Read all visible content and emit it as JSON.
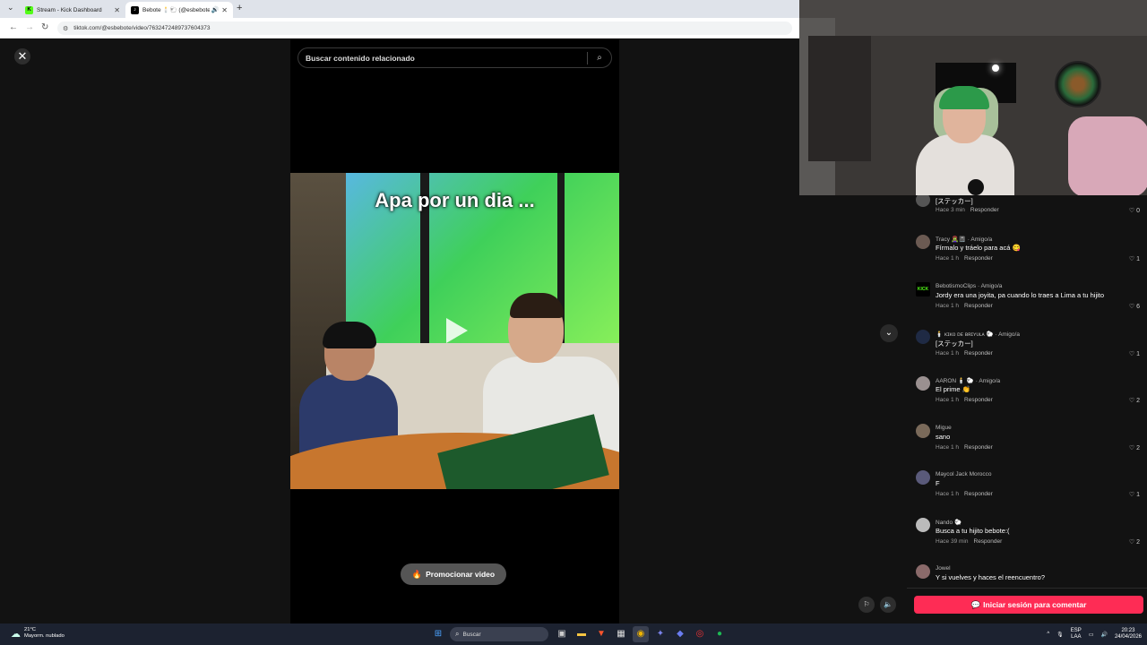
{
  "browser": {
    "tabs": [
      {
        "favicon": "K",
        "title": "Stream - Kick Dashboard"
      },
      {
        "favicon": "♪",
        "title": "Bebote 🕯️🐑 (@esbebote)"
      }
    ],
    "url": "tiktok.com/@esbebote/video/7632472489737604373"
  },
  "tiktok": {
    "search_placeholder": "Buscar contenido relacionado",
    "video_caption": "Apa por un dia ...",
    "promote_label": "Promocionar video",
    "login_to_comment": "Iniciar sesión para comentar"
  },
  "comments": [
    {
      "user": "",
      "text": "[ステッカー]",
      "time": "Hace 3 min",
      "reply": "Responder",
      "likes": "0"
    },
    {
      "user": "Tracy 🧟‍♀️📓 · Amigo/a",
      "text": "Fírmalo y tráelo para acá 😋",
      "time": "Hace 1 h",
      "reply": "Responder",
      "likes": "1"
    },
    {
      "user": "BebotismoClips · Amigo/a",
      "text": "Jordy era una joyita, pa cuando lo traes a Lima a tu hijito",
      "time": "Hace 1 h",
      "reply": "Responder",
      "likes": "6"
    },
    {
      "user": "🕯️ ᴋɪᴋᴏ ᴅᴇ ʙʀɪʏᴜʟᴀ 🐑 · Amigo/a",
      "text": "[ステッカー]",
      "time": "Hace 1 h",
      "reply": "Responder",
      "likes": "1"
    },
    {
      "user": "AARON 🕯️ 🐑 · Amigo/a",
      "text": "El prime 👏",
      "time": "Hace 1 h",
      "reply": "Responder",
      "likes": "2"
    },
    {
      "user": "Migue",
      "text": "sano",
      "time": "Hace 1 h",
      "reply": "Responder",
      "likes": "2"
    },
    {
      "user": "Maycol Jack Morocco",
      "text": "F",
      "time": "Hace 1 h",
      "reply": "Responder",
      "likes": "1"
    },
    {
      "user": "Nando 🐑",
      "text": "Busca a tu hijito bebote:(",
      "time": "Hace 39 min",
      "reply": "Responder",
      "likes": "2"
    },
    {
      "user": "Jowel",
      "text": "Y si vuelves y haces el reencuentro?",
      "time": "",
      "reply": "",
      "likes": ""
    }
  ],
  "taskbar": {
    "temp": "21°C",
    "weather": "Mayorm. nublado",
    "search_placeholder": "Buscar",
    "lang_1": "ESP",
    "lang_2": "LAA",
    "time": "20:23",
    "date": "24/04/2026"
  },
  "colors": {
    "accent": "#fe2c55",
    "kick_green": "#53fc18",
    "page_bg": "#121212"
  }
}
